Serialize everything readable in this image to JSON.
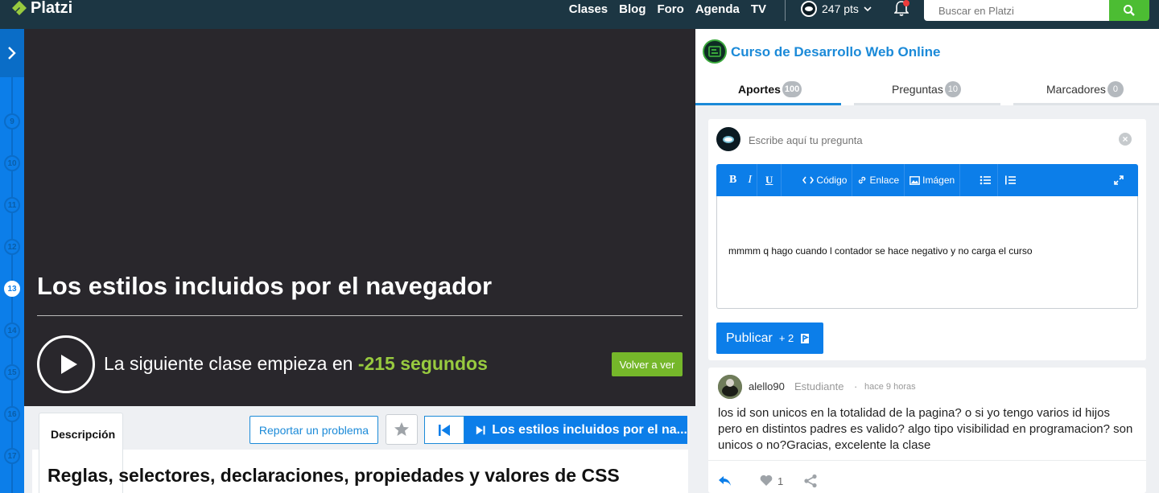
{
  "header": {
    "brand": "Platzi",
    "nav": [
      "Clases",
      "Blog",
      "Foro",
      "Agenda",
      "TV"
    ],
    "points": "247 pts",
    "search_placeholder": "Buscar en Platzi"
  },
  "rail": {
    "steps": [
      "9",
      "10",
      "11",
      "12",
      "13",
      "14",
      "15",
      "16",
      "17"
    ],
    "current": "13"
  },
  "video": {
    "title": "Los estilos incluidos por el navegador",
    "next_prefix": "La siguiente clase empieza en",
    "next_seconds": "-215 segundos",
    "replay_label": "Volver a ver"
  },
  "lower": {
    "desc_tab": "Descripción",
    "report_label": "Reportar un problema",
    "next_class_label": "Los estilos incluidos por el na...",
    "section_title": "Reglas, selectores, declaraciones, propiedades y valores de CSS"
  },
  "course": {
    "title": "Curso de Desarrollo Web Online",
    "tabs": [
      {
        "label": "Aportes",
        "count": "100"
      },
      {
        "label": "Preguntas",
        "count": "10"
      },
      {
        "label": "Marcadores",
        "count": "0"
      }
    ]
  },
  "ask": {
    "placeholder": "Escribe aquí tu pregunta",
    "toolbar": {
      "bold": "B",
      "italic": "I",
      "underline": "U",
      "code": "Código",
      "link": "Enlace",
      "image": "Imágen"
    },
    "editor_text": "mmmm q hago cuando l contador se hace negativo y no carga el curso",
    "publish_label": "Publicar",
    "publish_points": "+ 2"
  },
  "post": {
    "user": "alello90",
    "role": "Estudiante",
    "separator": "·",
    "time": "hace 9 horas",
    "body": "los id son unicos en la totalidad de la pagina? o si yo tengo varios id hijos pero en distintos padres es valido? algo tipo visibilidad en programacion? son unicos o no?Gracias, excelente la clase",
    "likes": "1"
  },
  "colors": {
    "brand_green": "#98ca3f",
    "primary_blue": "#0c7ee9",
    "header_bg": "#1c3643"
  }
}
